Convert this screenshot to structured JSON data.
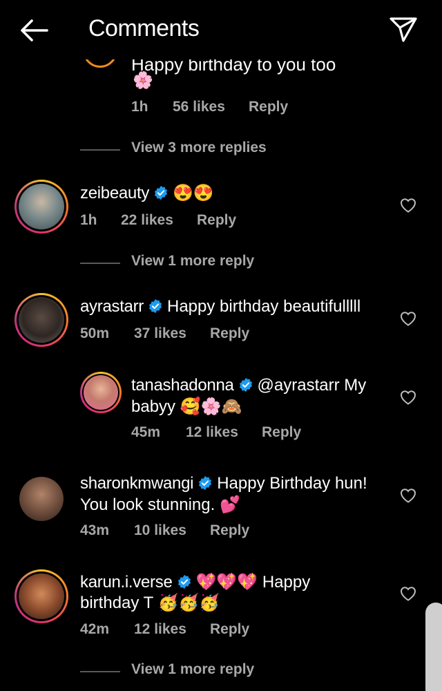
{
  "header": {
    "title": "Comments"
  },
  "partial": {
    "text": "Happy birthday to you too",
    "emoji": "🌸",
    "time": "1h",
    "likes": "56 likes",
    "reply": "Reply",
    "view_more": "View 3 more replies"
  },
  "comments": [
    {
      "username": "zeibeauty",
      "text": "😍😍",
      "time": "1h",
      "likes": "22 likes",
      "reply": "Reply",
      "view_more": "View 1 more reply"
    },
    {
      "username": "ayrastarr",
      "text": "Happy birthday beautifulllll",
      "time": "50m",
      "likes": "37 likes",
      "reply": "Reply"
    },
    {
      "username": "tanashadonna",
      "text_line1": "@ayrastarr My",
      "text_line2": "babyy 🥰🌸🙈",
      "time": "45m",
      "likes": "12 likes",
      "reply": "Reply"
    },
    {
      "username": "sharonkmwangi",
      "text_line1": "Happy Birthday hun!",
      "text_line2": "You look stunning. 💕",
      "time": "43m",
      "likes": "10 likes",
      "reply": "Reply"
    },
    {
      "username": "karun.i.verse",
      "text_line1": "💖💖💖 Happy",
      "text_line2": "birthday T 🥳🥳🥳",
      "time": "42m",
      "likes": "12 likes",
      "reply": "Reply",
      "view_more": "View 1 more reply"
    }
  ],
  "colors": {
    "verified": "#1d9bf0",
    "meta": "#a8a8a8",
    "background": "#000000"
  },
  "icons": [
    "back-arrow-icon",
    "send-icon",
    "verified-badge-icon",
    "heart-icon"
  ]
}
